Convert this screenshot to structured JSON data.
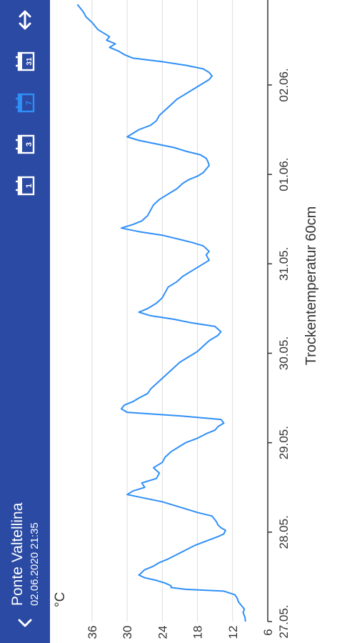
{
  "header": {
    "title": "Ponte Valtellina",
    "subtitle": "02.06.2020 21:35",
    "periods": [
      "1",
      "3",
      "7",
      "31"
    ],
    "active_period": "7"
  },
  "colors": {
    "header_bg": "#2a4aa3",
    "icon": "#ffffff",
    "active_icon": "#2f8ff7",
    "line": "#2f8ff7",
    "grid": "#dddddd",
    "axis": "#333333",
    "text": "#333333"
  },
  "chart_data": {
    "type": "line",
    "title": "",
    "xlabel": "Trockentemperatur 60cm",
    "ylabel": "°C",
    "ylim": [
      6,
      40
    ],
    "yticks": [
      6,
      12,
      18,
      24,
      30,
      36
    ],
    "xlim": [
      0,
      6.95
    ],
    "xticks": [
      {
        "x": 0,
        "label": "27.05."
      },
      {
        "x": 1,
        "label": "28.05."
      },
      {
        "x": 2,
        "label": "29.05."
      },
      {
        "x": 3,
        "label": "30.05."
      },
      {
        "x": 4,
        "label": "31.05."
      },
      {
        "x": 5,
        "label": "01.06."
      },
      {
        "x": 6,
        "label": "02.06."
      }
    ],
    "grid": true,
    "series": [
      {
        "name": "",
        "points": [
          [
            0.0,
            9.8
          ],
          [
            0.05,
            9.9
          ],
          [
            0.1,
            10.2
          ],
          [
            0.14,
            10.0
          ],
          [
            0.18,
            10.5
          ],
          [
            0.22,
            11.0
          ],
          [
            0.26,
            11.2
          ],
          [
            0.3,
            11.6
          ],
          [
            0.34,
            13.5
          ],
          [
            0.36,
            20.0
          ],
          [
            0.38,
            22.5
          ],
          [
            0.4,
            22.5
          ],
          [
            0.43,
            23.5
          ],
          [
            0.46,
            25.0
          ],
          [
            0.49,
            27.0
          ],
          [
            0.52,
            28.0
          ],
          [
            0.55,
            27.5
          ],
          [
            0.58,
            27.0
          ],
          [
            0.62,
            25.5
          ],
          [
            0.66,
            24.5
          ],
          [
            0.7,
            23.0
          ],
          [
            0.75,
            21.5
          ],
          [
            0.8,
            20.0
          ],
          [
            0.85,
            18.5
          ],
          [
            0.9,
            16.5
          ],
          [
            0.95,
            14.5
          ],
          [
            0.98,
            13.5
          ],
          [
            1.02,
            13.2
          ],
          [
            1.05,
            14.0
          ],
          [
            1.08,
            14.5
          ],
          [
            1.12,
            14.8
          ],
          [
            1.18,
            15.5
          ],
          [
            1.22,
            18.0
          ],
          [
            1.26,
            20.0
          ],
          [
            1.3,
            22.0
          ],
          [
            1.34,
            24.0
          ],
          [
            1.38,
            27.0
          ],
          [
            1.42,
            30.0
          ],
          [
            1.46,
            29.0
          ],
          [
            1.5,
            27.0
          ],
          [
            1.55,
            27.5
          ],
          [
            1.6,
            25.0
          ],
          [
            1.66,
            24.5
          ],
          [
            1.72,
            25.5
          ],
          [
            1.78,
            24.0
          ],
          [
            1.84,
            23.5
          ],
          [
            1.9,
            22.5
          ],
          [
            1.96,
            21.0
          ],
          [
            2.0,
            20.0
          ],
          [
            2.05,
            18.0
          ],
          [
            2.1,
            16.5
          ],
          [
            2.14,
            15.0
          ],
          [
            2.18,
            14.5
          ],
          [
            2.22,
            13.5
          ],
          [
            2.26,
            14.0
          ],
          [
            2.3,
            21.0
          ],
          [
            2.34,
            30.0
          ],
          [
            2.38,
            31.0
          ],
          [
            2.42,
            30.5
          ],
          [
            2.46,
            29.0
          ],
          [
            2.5,
            28.0
          ],
          [
            2.55,
            26.5
          ],
          [
            2.6,
            26.0
          ],
          [
            2.66,
            25.0
          ],
          [
            2.72,
            24.0
          ],
          [
            2.78,
            23.0
          ],
          [
            2.84,
            22.0
          ],
          [
            2.9,
            21.0
          ],
          [
            2.96,
            19.5
          ],
          [
            3.02,
            18.0
          ],
          [
            3.08,
            17.0
          ],
          [
            3.14,
            16.0
          ],
          [
            3.2,
            14.5
          ],
          [
            3.24,
            14.0
          ],
          [
            3.3,
            15.0
          ],
          [
            3.34,
            19.0
          ],
          [
            3.38,
            22.0
          ],
          [
            3.42,
            26.0
          ],
          [
            3.46,
            28.0
          ],
          [
            3.5,
            26.5
          ],
          [
            3.56,
            25.0
          ],
          [
            3.62,
            24.0
          ],
          [
            3.68,
            23.5
          ],
          [
            3.74,
            23.0
          ],
          [
            3.8,
            21.5
          ],
          [
            3.86,
            20.5
          ],
          [
            3.92,
            19.0
          ],
          [
            3.98,
            17.5
          ],
          [
            4.04,
            16.0
          ],
          [
            4.1,
            16.5
          ],
          [
            4.14,
            16.0
          ],
          [
            4.2,
            17.0
          ],
          [
            4.24,
            19.0
          ],
          [
            4.28,
            21.5
          ],
          [
            4.32,
            24.0
          ],
          [
            4.36,
            28.0
          ],
          [
            4.4,
            31.0
          ],
          [
            4.44,
            29.0
          ],
          [
            4.48,
            27.5
          ],
          [
            4.54,
            26.5
          ],
          [
            4.6,
            26.0
          ],
          [
            4.66,
            25.5
          ],
          [
            4.72,
            24.5
          ],
          [
            4.78,
            23.0
          ],
          [
            4.84,
            21.5
          ],
          [
            4.9,
            20.5
          ],
          [
            4.94,
            19.5
          ],
          [
            4.98,
            18.0
          ],
          [
            5.02,
            17.0
          ],
          [
            5.06,
            16.5
          ],
          [
            5.1,
            16.0
          ],
          [
            5.14,
            16.2
          ],
          [
            5.18,
            16.5
          ],
          [
            5.22,
            17.5
          ],
          [
            5.26,
            20.0
          ],
          [
            5.3,
            22.0
          ],
          [
            5.34,
            25.0
          ],
          [
            5.38,
            28.0
          ],
          [
            5.42,
            30.0
          ],
          [
            5.46,
            29.0
          ],
          [
            5.5,
            28.0
          ],
          [
            5.55,
            26.0
          ],
          [
            5.6,
            25.0
          ],
          [
            5.66,
            24.5
          ],
          [
            5.72,
            23.5
          ],
          [
            5.78,
            22.5
          ],
          [
            5.84,
            21.5
          ],
          [
            5.9,
            20.0
          ],
          [
            5.96,
            18.5
          ],
          [
            6.02,
            17.0
          ],
          [
            6.06,
            16.0
          ],
          [
            6.1,
            15.5
          ],
          [
            6.14,
            16.0
          ],
          [
            6.18,
            17.0
          ],
          [
            6.22,
            20.0
          ],
          [
            6.26,
            24.0
          ],
          [
            6.3,
            29.0
          ],
          [
            6.34,
            30.5
          ],
          [
            6.38,
            31.5
          ],
          [
            6.42,
            33.0
          ],
          [
            6.46,
            32.0
          ],
          [
            6.5,
            33.5
          ],
          [
            6.54,
            33.0
          ],
          [
            6.58,
            34.0
          ],
          [
            6.62,
            35.0
          ],
          [
            6.66,
            35.5
          ],
          [
            6.7,
            36.0
          ],
          [
            6.76,
            37.0
          ],
          [
            6.82,
            37.5
          ],
          [
            6.86,
            38.0
          ],
          [
            6.9,
            38.5
          ]
        ]
      }
    ]
  }
}
